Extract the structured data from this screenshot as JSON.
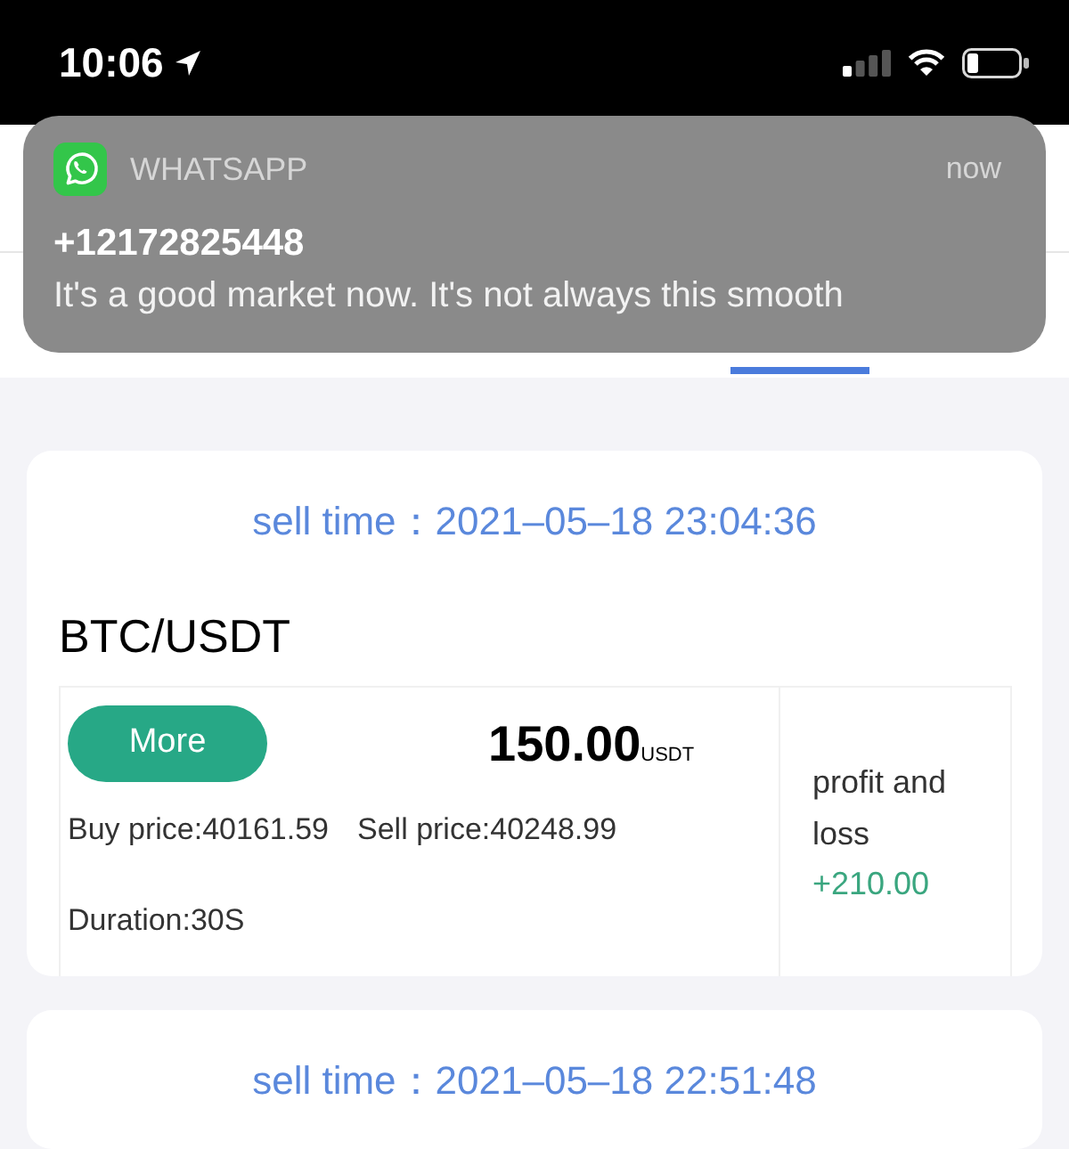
{
  "status_bar": {
    "time": "10:06"
  },
  "notification": {
    "app": "WHATSAPP",
    "time": "now",
    "sender": "+12172825448",
    "message": "It's a good market now. It's not always this smooth"
  },
  "orders": [
    {
      "sell_time": "sell time：2021–05–18 23:04:36",
      "pair": "BTC/USDT",
      "button": "More",
      "amount": "150.00",
      "unit": "USDT",
      "buy_price": "Buy price:40161.59",
      "sell_price": "Sell price:40248.99",
      "duration": "Duration:30S",
      "pnl_label": "profit and loss",
      "pnl": "+210.00"
    },
    {
      "sell_time": "sell time：2021–05–18 22:51:48"
    }
  ]
}
